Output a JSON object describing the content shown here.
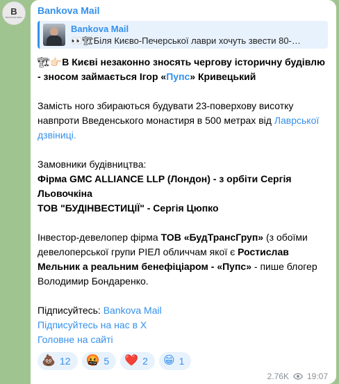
{
  "channel": {
    "name": "Bankova Mail",
    "avatar_letter": "B",
    "avatar_caption": "BANKOVA MAIL"
  },
  "reply": {
    "title": "Bankova Mail",
    "preview": "👀🏗Біля Києво-Печерської лаври хочуть звести 80-…"
  },
  "message": {
    "line1_prefix": "🏗👉🏻",
    "line1_bold": "В Києві незаконно зносять чергову історичну будівлю - зносом займається Ігор «",
    "line1_link": "Пупс",
    "line1_bold_end": "» Кривецький",
    "p2_text": "Замість ного збираються будувати 23-поверхову висотку навпроти Введенського монастиря в 500 метрах від ",
    "p2_link": "Лаврської дзвіниці.",
    "p3_label": "Замовники будівництва:",
    "p3_line1": "Фірма GMC ALLIANCE LLP (Лондон) - з орбіти Сергія Льовочкіна",
    "p3_line2": "ТОВ \"БУДІНВЕСТИЦІЇ\" - Сергія Цюпко",
    "p4_a": "Інвестор-девелопер фірма ",
    "p4_b": "ТОВ «БудТрансГруп»",
    "p4_c": " (з обоїми девелоперської групи РІЕЛ обличчам якої є ",
    "p4_d": "Ростислав Мельник а реальним бенефіціаром - «Пупс»",
    "p4_e": " - пише блогер Володимир Бондаренко.",
    "subscribe_label": "Підписуйтесь: ",
    "subscribe_link": "Bankova Mail",
    "x_link": "Підписуйтесь на нас в Х",
    "site_link": "Головне на сайті"
  },
  "reactions": [
    {
      "emoji": "💩",
      "count": "12"
    },
    {
      "emoji": "🤬",
      "count": "5"
    },
    {
      "emoji": "❤️",
      "count": "2"
    },
    {
      "emoji": "😁",
      "count": "1"
    }
  ],
  "meta": {
    "views": "2.76K",
    "time": "19:07"
  },
  "colors": {
    "accent": "#3390ec",
    "background": "#9fc48f",
    "bubble": "#ffffff"
  }
}
